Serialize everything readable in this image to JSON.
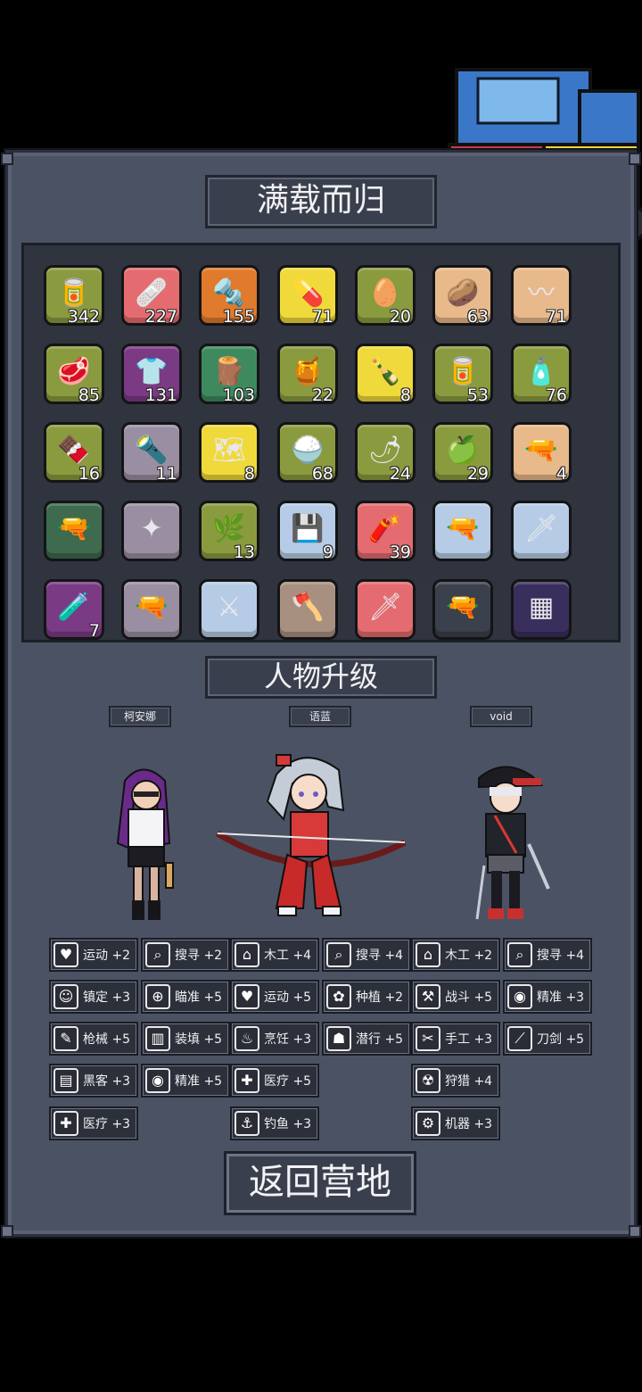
{
  "header": {
    "title": "满载而归"
  },
  "inventory": [
    {
      "icon": "🥫",
      "count": "342",
      "bg": "#8a9a3e"
    },
    {
      "icon": "🩹",
      "count": "227",
      "bg": "#e46b6f"
    },
    {
      "icon": "🔩",
      "count": "155",
      "bg": "#e07a2c"
    },
    {
      "icon": "💊",
      "count": "71",
      "bg": "#f0d93a"
    },
    {
      "icon": "🥚",
      "count": "20",
      "bg": "#8a9a3e"
    },
    {
      "icon": "🥔",
      "count": "63",
      "bg": "#e8b98a"
    },
    {
      "icon": "〰",
      "count": "71",
      "bg": "#e8b98a"
    },
    {
      "icon": "🥩",
      "count": "85",
      "bg": "#8a9a3e"
    },
    {
      "icon": "👕",
      "count": "131",
      "bg": "#7a3a84"
    },
    {
      "icon": "🪵",
      "count": "103",
      "bg": "#3e8a5e"
    },
    {
      "icon": "🍯",
      "count": "22",
      "bg": "#8a9a3e"
    },
    {
      "icon": "🍾",
      "count": "8",
      "bg": "#f0d93a"
    },
    {
      "icon": "🥫",
      "count": "53",
      "bg": "#8a9a3e"
    },
    {
      "icon": "🧴",
      "count": "76",
      "bg": "#8a9a3e"
    },
    {
      "icon": "🍫",
      "count": "16",
      "bg": "#8a9a3e"
    },
    {
      "icon": "🔦",
      "count": "11",
      "bg": "#9a8fa2"
    },
    {
      "icon": "🗺",
      "count": "8",
      "bg": "#f0d93a"
    },
    {
      "icon": "🍚",
      "count": "68",
      "bg": "#8a9a3e"
    },
    {
      "icon": "🌶",
      "count": "24",
      "bg": "#8a9a3e"
    },
    {
      "icon": "🍏",
      "count": "29",
      "bg": "#8a9a3e"
    },
    {
      "icon": "🔫",
      "count": "4",
      "bg": "#e8b98a"
    },
    {
      "icon": "🔫",
      "count": "",
      "bg": "#3e6a4e"
    },
    {
      "icon": "✦",
      "count": "",
      "bg": "#9a8fa2"
    },
    {
      "icon": "🌿",
      "count": "13",
      "bg": "#8a9a3e"
    },
    {
      "icon": "💾",
      "count": "9",
      "bg": "#b6cbe6"
    },
    {
      "icon": "🧨",
      "count": "39",
      "bg": "#e46b6f"
    },
    {
      "icon": "🔫",
      "count": "",
      "bg": "#b6cbe6"
    },
    {
      "icon": "🗡",
      "count": "",
      "bg": "#b6cbe6"
    },
    {
      "icon": "🧪",
      "count": "7",
      "bg": "#7a3a84"
    },
    {
      "icon": "🔫",
      "count": "",
      "bg": "#9a8fa2"
    },
    {
      "icon": "⚔",
      "count": "",
      "bg": "#b6cbe6"
    },
    {
      "icon": "🪓",
      "count": "",
      "bg": "#a89080"
    },
    {
      "icon": "🗡",
      "count": "",
      "bg": "#e46b6f"
    },
    {
      "icon": "🔫",
      "count": "",
      "bg": "#3a404c"
    },
    {
      "icon": "▦",
      "count": "",
      "bg": "#3a2f5c"
    }
  ],
  "upgrade": {
    "title": "人物升级"
  },
  "characters": [
    {
      "name": "柯安娜"
    },
    {
      "name": "语蓝"
    },
    {
      "name": "void"
    }
  ],
  "skills": [
    [
      {
        "icon": "♥",
        "label": "运动 +2"
      },
      {
        "icon": "⌕",
        "label": "搜寻 +2"
      },
      {
        "icon": "⌂",
        "label": "木工 +4"
      },
      {
        "icon": "⌕",
        "label": "搜寻 +4"
      },
      {
        "icon": "⌂",
        "label": "木工 +2"
      },
      {
        "icon": "⌕",
        "label": "搜寻 +4"
      }
    ],
    [
      {
        "icon": "☺",
        "label": "镇定 +3"
      },
      {
        "icon": "⊕",
        "label": "瞄准 +5"
      },
      {
        "icon": "♥",
        "label": "运动 +5"
      },
      {
        "icon": "✿",
        "label": "种植 +2"
      },
      {
        "icon": "⚒",
        "label": "战斗 +5"
      },
      {
        "icon": "◉",
        "label": "精准 +3"
      }
    ],
    [
      {
        "icon": "✎",
        "label": "枪械 +5"
      },
      {
        "icon": "▥",
        "label": "装填 +5"
      },
      {
        "icon": "♨",
        "label": "烹饪 +3"
      },
      {
        "icon": "☗",
        "label": "潜行 +5"
      },
      {
        "icon": "✂",
        "label": "手工 +3"
      },
      {
        "icon": "⟋",
        "label": "刀剑 +5"
      }
    ],
    [
      {
        "icon": "▤",
        "label": "黑客 +3"
      },
      {
        "icon": "◉",
        "label": "精准 +5"
      },
      {
        "icon": "✚",
        "label": "医疗 +5"
      },
      null,
      {
        "icon": "☢",
        "label": "狩猎 +4"
      },
      null
    ],
    [
      {
        "icon": "✚",
        "label": "医疗 +3"
      },
      null,
      {
        "icon": "⚓",
        "label": "钓鱼 +3"
      },
      null,
      {
        "icon": "⚙",
        "label": "机器 +3"
      },
      null
    ]
  ],
  "footer": {
    "back_label": "返回营地"
  }
}
